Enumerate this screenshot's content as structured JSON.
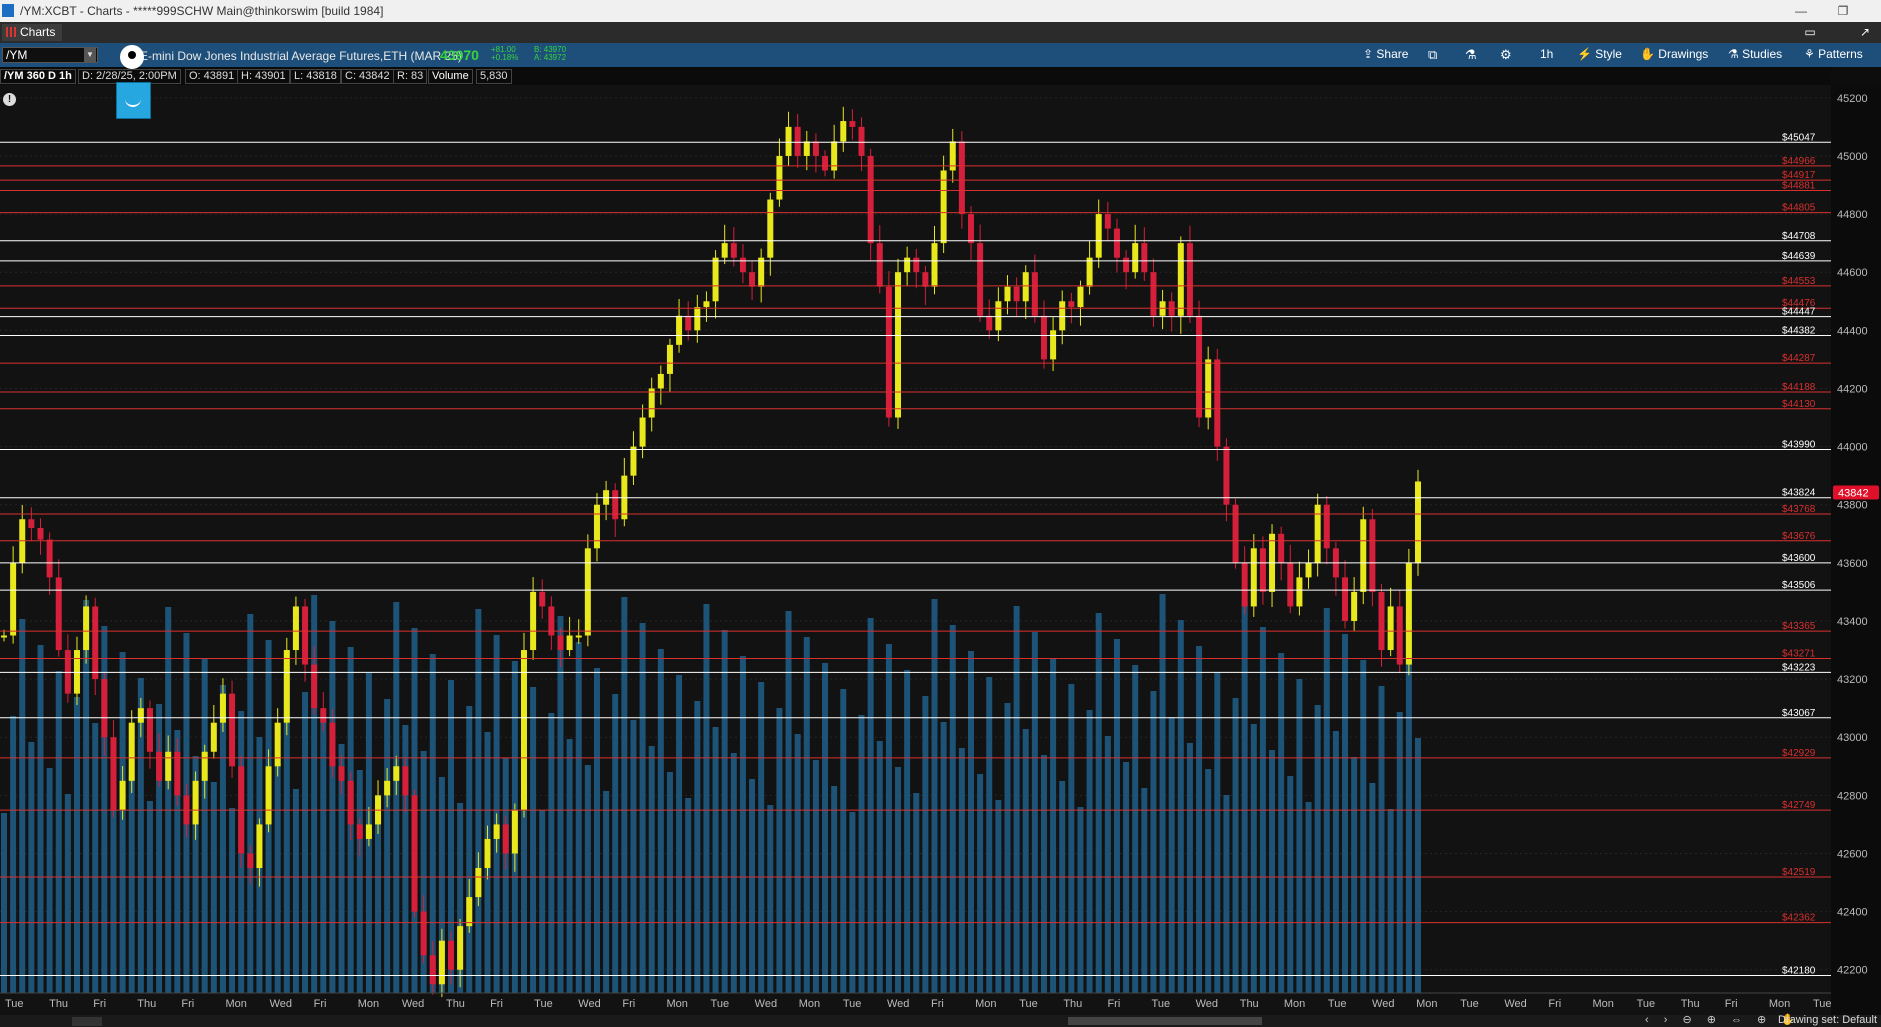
{
  "window": {
    "title": "/YM:XCBT - Charts - *****999SCHW Main@thinkorswim [build 1984]"
  },
  "tabs": [
    {
      "label": "Charts"
    }
  ],
  "toolbar": {
    "symbol": "/YM",
    "instrument": "E-mini Dow Jones Industrial Average Futures,ETH (MAR 25)",
    "last": "43970",
    "change": "+81.00",
    "change_pct": "+0.18%",
    "bid": "B: 43970",
    "ask": "A: 43972",
    "share_label": "Share",
    "timeframe_label": "1h",
    "style_label": "Style",
    "drawings_label": "Drawings",
    "studies_label": "Studies",
    "patterns_label": "Patterns"
  },
  "infobar": {
    "study_name": "/YM 360 D 1h",
    "date": "D: 2/28/25, 2:00PM",
    "open": "O: 43891",
    "high": "H: 43901",
    "low": "L: 43818",
    "close": "C: 43842",
    "range": "R: 83",
    "volume_label": "Volume",
    "volume_value": "5,830"
  },
  "status": {
    "drawing_set": "Drawing set: Default"
  },
  "colors": {
    "up_candle": "#e8e81c",
    "down_candle": "#d61f3a",
    "volume": "#1f5f8a",
    "level_white": "#ffffff",
    "level_red": "#d83030",
    "current_price_badge": "#e0102a",
    "background": "#0d0d0d"
  },
  "chart_data": {
    "type": "candlestick",
    "symbol": "/YM",
    "aggregation": "1h",
    "ylim": [
      42120,
      45220
    ],
    "y_ticks": [
      42200,
      42400,
      42600,
      42800,
      43000,
      43200,
      43400,
      43600,
      43800,
      44000,
      44200,
      44400,
      44600,
      44800,
      45000,
      45200
    ],
    "current_price": 43842,
    "x_labels": [
      "Tue",
      "Thu",
      "Fri",
      "Thu",
      "Fri",
      "Mon",
      "Wed",
      "Fri",
      "Mon",
      "Wed",
      "Thu",
      "Fri",
      "Tue",
      "Wed",
      "Fri",
      "Mon",
      "Tue",
      "Wed",
      "Mon",
      "Tue",
      "Wed",
      "Fri",
      "Mon",
      "Tue",
      "Thu",
      "Fri",
      "Tue",
      "Wed",
      "Thu",
      "Mon",
      "Tue",
      "Wed",
      "Mon",
      "Tue",
      "Wed",
      "Fri",
      "Mon",
      "Tue",
      "Thu",
      "Fri",
      "Mon",
      "Tue"
    ],
    "levels": [
      {
        "price": 45047,
        "label": "45047",
        "color": "white"
      },
      {
        "price": 44966,
        "label": "44966",
        "color": "red"
      },
      {
        "price": 44917,
        "label": "44917",
        "color": "red"
      },
      {
        "price": 44881,
        "label": "44881",
        "color": "red"
      },
      {
        "price": 44805,
        "label": "44805",
        "color": "red"
      },
      {
        "price": 44708,
        "label": "44708",
        "color": "white"
      },
      {
        "price": 44639,
        "label": "44639",
        "color": "white"
      },
      {
        "price": 44553,
        "label": "44553",
        "color": "red"
      },
      {
        "price": 44476,
        "label": "44476",
        "color": "red"
      },
      {
        "price": 44447,
        "label": "44447",
        "color": "white"
      },
      {
        "price": 44382,
        "label": "44382",
        "color": "white"
      },
      {
        "price": 44287,
        "label": "44287",
        "color": "red"
      },
      {
        "price": 44188,
        "label": "44188",
        "color": "red"
      },
      {
        "price": 44130,
        "label": "44130",
        "color": "red"
      },
      {
        "price": 43990,
        "label": "43990",
        "color": "white"
      },
      {
        "price": 43824,
        "label": "43824",
        "color": "white"
      },
      {
        "price": 43768,
        "label": "43768",
        "color": "red"
      },
      {
        "price": 43676,
        "label": "43676",
        "color": "red"
      },
      {
        "price": 43600,
        "label": "43600",
        "color": "white"
      },
      {
        "price": 43506,
        "label": "43506",
        "color": "white"
      },
      {
        "price": 43365,
        "label": "43365",
        "color": "red"
      },
      {
        "price": 43271,
        "label": "43271",
        "color": "red"
      },
      {
        "price": 43223,
        "label": "43223",
        "color": "white"
      },
      {
        "price": 43067,
        "label": "43067",
        "color": "white"
      },
      {
        "price": 42929,
        "label": "42929",
        "color": "red"
      },
      {
        "price": 42749,
        "label": "42749",
        "color": "red"
      },
      {
        "price": 42519,
        "label": "42519",
        "color": "red"
      },
      {
        "price": 42362,
        "label": "42362",
        "color": "red"
      },
      {
        "price": 42180,
        "label": "42180",
        "color": "white"
      }
    ],
    "price_path": [
      43350,
      43600,
      43750,
      43720,
      43680,
      43550,
      43300,
      43150,
      43300,
      43450,
      43200,
      43000,
      42750,
      42850,
      43050,
      43100,
      42950,
      42850,
      42950,
      42800,
      42700,
      42850,
      42950,
      43050,
      43150,
      42900,
      42600,
      42550,
      42700,
      42900,
      43050,
      43300,
      43450,
      43250,
      43100,
      43050,
      42900,
      42850,
      42700,
      42650,
      42700,
      42800,
      42850,
      42900,
      42800,
      42400,
      42250,
      42150,
      42300,
      42200,
      42350,
      42450,
      42550,
      42650,
      42700,
      42600,
      42750,
      43300,
      43500,
      43450,
      43350,
      43300,
      43350,
      43350,
      43650,
      43800,
      43850,
      43750,
      43900,
      44000,
      44100,
      44200,
      44250,
      44350,
      44450,
      44400,
      44480,
      44500,
      44650,
      44700,
      44650,
      44600,
      44550,
      44650,
      44850,
      45000,
      45100,
      45000,
      45050,
      45000,
      44950,
      45050,
      45120,
      45100,
      45000,
      44700,
      44550,
      44100,
      44600,
      44650,
      44600,
      44550,
      44700,
      44950,
      45050,
      44800,
      44700,
      44450,
      44400,
      44500,
      44550,
      44500,
      44600,
      44450,
      44300,
      44400,
      44500,
      44480,
      44550,
      44650,
      44800,
      44750,
      44650,
      44600,
      44700,
      44600,
      44450,
      44500,
      44450,
      44700,
      44450,
      44100,
      44300,
      44000,
      43800,
      43600,
      43450,
      43650,
      43500,
      43700,
      43600,
      43450,
      43550,
      43600,
      43800,
      43650,
      43550,
      43400,
      43500,
      43750,
      43500,
      43300,
      43450,
      43250,
      43600,
      43880
    ]
  }
}
